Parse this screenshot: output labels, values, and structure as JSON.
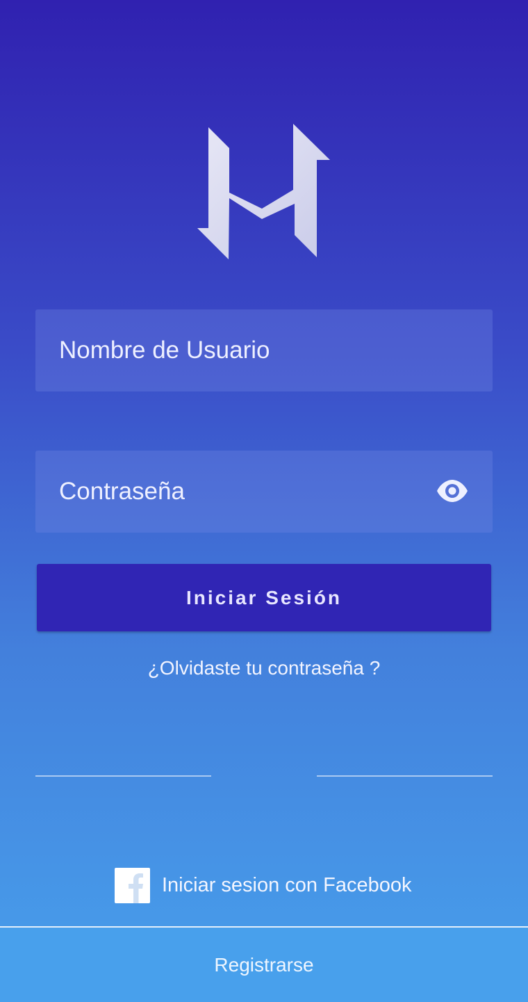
{
  "login": {
    "username_placeholder": "Nombre de Usuario",
    "password_placeholder": "Contraseña",
    "submit_label": "Iniciar Sesión",
    "forgot_label": "¿Olvidaste tu contraseña ?"
  },
  "social": {
    "facebook_label": "Iniciar sesion con Facebook"
  },
  "footer": {
    "register_label": "Registrarse"
  },
  "icons": {
    "logo": "app-logo",
    "password_toggle": "eye-icon",
    "facebook": "facebook-icon"
  },
  "colors": {
    "gradient_top": "#3021b0",
    "gradient_bottom": "#48a0ec",
    "primary_button": "#3025b4",
    "facebook_icon": "#d6e4f5"
  }
}
